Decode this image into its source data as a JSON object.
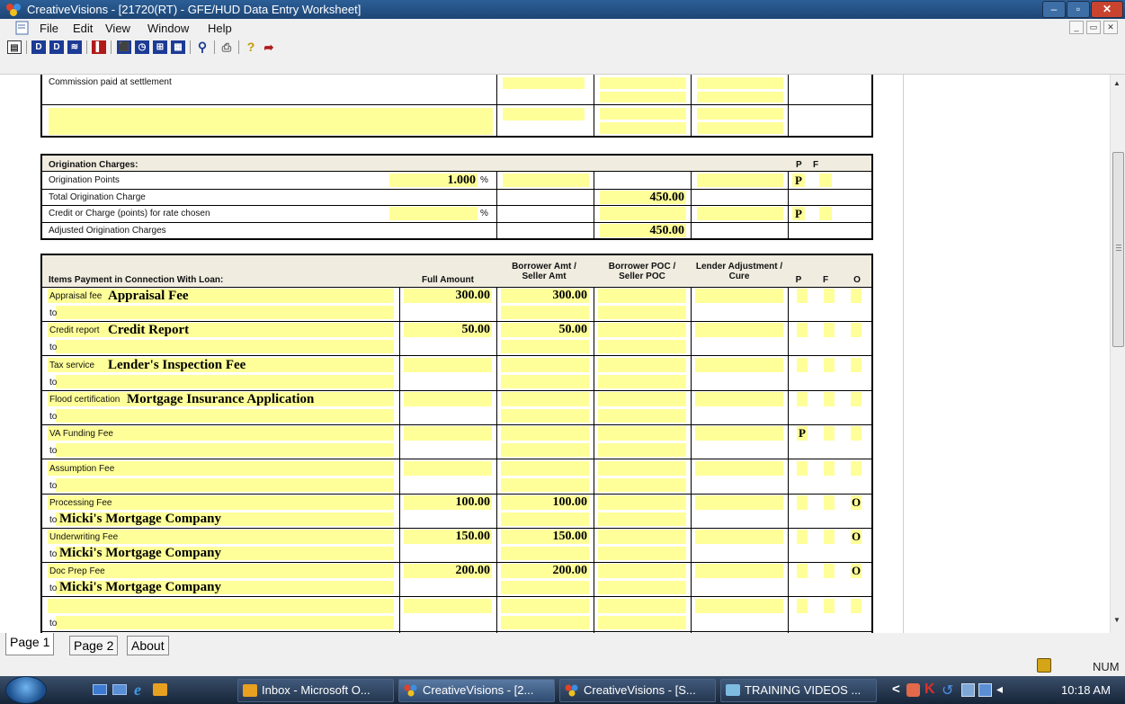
{
  "window": {
    "title": "CreativeVisions - [21720(RT) - GFE/HUD Data Entry Worksheet]"
  },
  "menu": [
    "File",
    "Edit",
    "View",
    "Window",
    "Help"
  ],
  "commission": {
    "label": "Commission paid at settlement"
  },
  "origination": {
    "heading": "Origination Charges:",
    "p_header": "P",
    "f_header": "F",
    "rows": [
      {
        "label": "Origination Points",
        "amount": "1.000",
        "unit": "%",
        "pf": "P"
      },
      {
        "label": "Total Origination Charge",
        "poc": "450.00"
      },
      {
        "label": "Credit or Charge (points) for rate chosen",
        "unit": "%",
        "pf": "P"
      },
      {
        "label": "Adjusted Origination Charges",
        "poc": "450.00"
      }
    ]
  },
  "items": {
    "heading": "Items Payment in Connection With Loan:",
    "col_full": "Full Amount",
    "col_borrower": "Borrower Amt / Seller Amt",
    "col_poc": "Borrower POC / Seller POC",
    "col_lender": "Lender Adjustment / Cure",
    "col_p": "P",
    "col_f": "F",
    "col_o": "O",
    "to_label": "to",
    "rows": [
      {
        "label": "Appraisal fee",
        "name": "Appraisal Fee",
        "full": "300.00",
        "borrower": "300.00",
        "p": "",
        "o": "",
        "to": ""
      },
      {
        "label": "Credit report",
        "name": "Credit Report",
        "full": "50.00",
        "borrower": "50.00",
        "p": "",
        "o": "",
        "to": ""
      },
      {
        "label": "Tax service",
        "name": "Lender's Inspection Fee",
        "full": "",
        "borrower": "",
        "p": "",
        "o": "",
        "to": ""
      },
      {
        "label": "Flood certification",
        "name": "Mortgage Insurance Application",
        "full": "",
        "borrower": "",
        "p": "",
        "o": "",
        "to": ""
      },
      {
        "label": "VA Funding Fee",
        "name": "",
        "full": "",
        "borrower": "",
        "p": "P",
        "o": "",
        "to": ""
      },
      {
        "label": "Assumption Fee",
        "name": "",
        "full": "",
        "borrower": "",
        "p": "",
        "o": "",
        "to": ""
      },
      {
        "label": "Processing Fee",
        "name": "",
        "full": "100.00",
        "borrower": "100.00",
        "p": "",
        "o": "O",
        "to": "Micki's Mortgage Company"
      },
      {
        "label": "Underwriting Fee",
        "name": "",
        "full": "150.00",
        "borrower": "150.00",
        "p": "",
        "o": "O",
        "to": "Micki's Mortgage Company"
      },
      {
        "label": "Doc Prep Fee",
        "name": "",
        "full": "200.00",
        "borrower": "200.00",
        "p": "",
        "o": "O",
        "to": "Micki's Mortgage Company"
      },
      {
        "label": "",
        "name": "",
        "full": "",
        "borrower": "",
        "p": "",
        "o": "",
        "to": ""
      }
    ]
  },
  "tabs": [
    "Page 1",
    "Page 2",
    "About"
  ],
  "status": {
    "num": "NUM"
  },
  "taskbar": {
    "items": [
      "Inbox - Microsoft O...",
      "CreativeVisions - [2...",
      "CreativeVisions - [S...",
      "TRAINING VIDEOS ..."
    ],
    "clock": "10:18 AM"
  }
}
